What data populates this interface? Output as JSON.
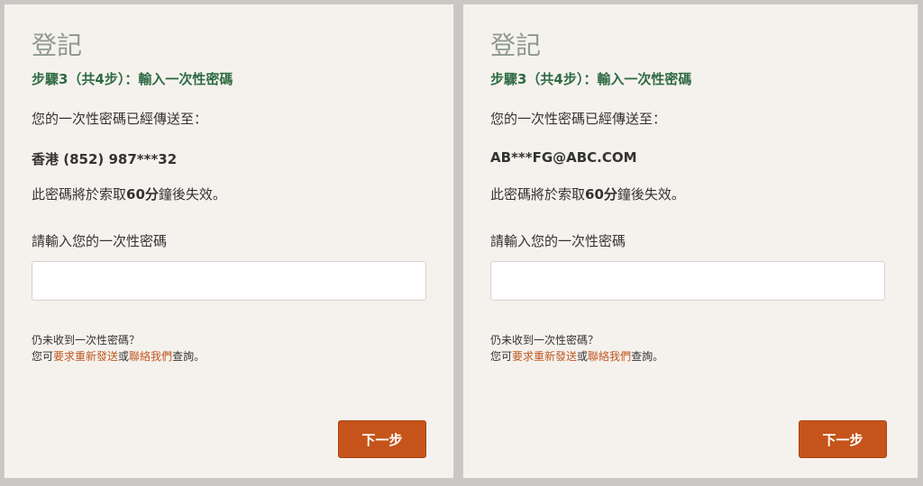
{
  "panels": [
    {
      "title": "登記",
      "step": "步驟3（共4步）：輸入一次性密碼",
      "sent_label": "您的一次性密碼已經傳送至：",
      "destination": "香港 (852) 987***32",
      "expiry_prefix": "此密碼將於索取",
      "expiry_bold": "60分",
      "expiry_suffix": "鐘後失效。",
      "input_label": "請輸入您的一次性密碼",
      "input_value": "",
      "not_received": "仍未收到一次性密碼？",
      "resend_prefix": "您可",
      "resend_link": "要求重新發送",
      "resend_or": "或",
      "contact_link": "聯絡我們",
      "resend_suffix": "查詢。",
      "next_label": "下一步"
    },
    {
      "title": "登記",
      "step": "步驟3（共4步）：輸入一次性密碼",
      "sent_label": "您的一次性密碼已經傳送至：",
      "destination": "AB***FG@ABC.COM",
      "expiry_prefix": "此密碼將於索取",
      "expiry_bold": "60分",
      "expiry_suffix": "鐘後失效。",
      "input_label": "請輸入您的一次性密碼",
      "input_value": "",
      "not_received": "仍未收到一次性密碼？",
      "resend_prefix": "您可",
      "resend_link": "要求重新發送",
      "resend_or": "或",
      "contact_link": "聯絡我們",
      "resend_suffix": "查詢。",
      "next_label": "下一步"
    }
  ],
  "colors": {
    "accent": "#c6541a",
    "step_green": "#2f6b43",
    "link": "#c0571e",
    "panel_bg": "#f5f2ee"
  }
}
